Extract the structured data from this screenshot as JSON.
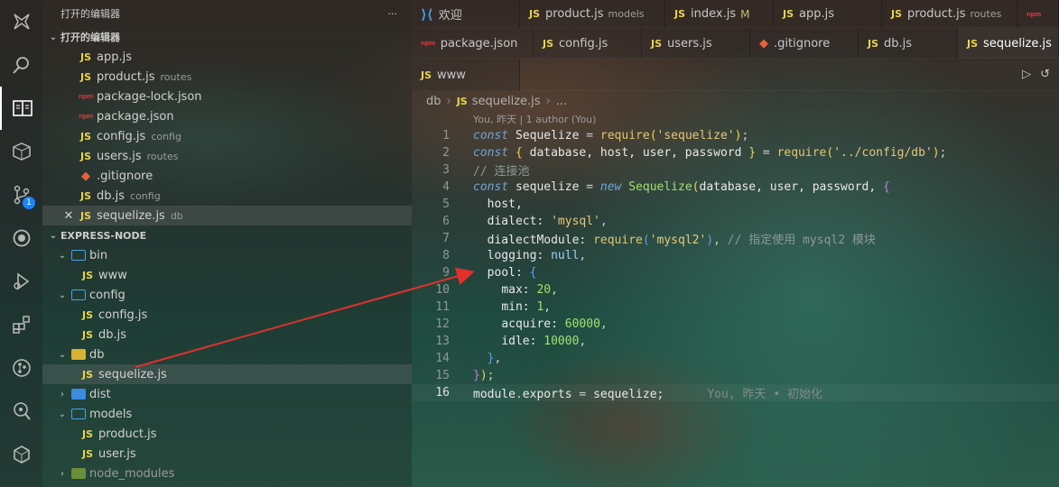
{
  "sidebar": {
    "title": "打开的编辑器",
    "more_label": "···",
    "open_editors_header": "打开的编辑器",
    "open_editors": [
      {
        "icon": "JS",
        "name": "app.js",
        "desc": ""
      },
      {
        "icon": "JS",
        "name": "product.js",
        "desc": "routes"
      },
      {
        "icon": "npm",
        "name": "package-lock.json",
        "desc": ""
      },
      {
        "icon": "npm",
        "name": "package.json",
        "desc": ""
      },
      {
        "icon": "JS",
        "name": "config.js",
        "desc": "config"
      },
      {
        "icon": "JS",
        "name": "users.js",
        "desc": "routes"
      },
      {
        "icon": "git",
        "name": ".gitignore",
        "desc": ""
      },
      {
        "icon": "JS",
        "name": "db.js",
        "desc": "config"
      },
      {
        "icon": "JS",
        "name": "sequelize.js",
        "desc": "db"
      }
    ],
    "project_header": "EXPRESS-NODE",
    "tree": {
      "bin": "bin",
      "bin_www": "www",
      "config": "config",
      "config_config": "config.js",
      "config_db": "db.js",
      "db": "db",
      "db_sequelize": "sequelize.js",
      "dist": "dist",
      "models": "models",
      "models_product": "product.js",
      "models_user": "user.js",
      "node_modules": "node_modules"
    }
  },
  "activity_badge": "1",
  "tabs_row1": [
    {
      "label": "欢迎",
      "desc": ""
    },
    {
      "label": "product.js",
      "desc": "models"
    },
    {
      "label": "index.js",
      "mod": "M"
    },
    {
      "label": "app.js",
      "desc": ""
    },
    {
      "label": "product.js",
      "desc": "routes"
    }
  ],
  "tabs_row2": [
    {
      "label": "package.json"
    },
    {
      "label": "config.js"
    },
    {
      "label": "users.js"
    },
    {
      "label": ".gitignore"
    },
    {
      "label": "db.js"
    },
    {
      "label": "sequelize.js"
    }
  ],
  "tabs_row3": [
    {
      "label": "www"
    }
  ],
  "breadcrumb": {
    "folder": "db",
    "file": "sequelize.js",
    "more": "..."
  },
  "blame_top": "You, 昨天 | 1 author (You)",
  "blame_inline": "You, 昨天 • 初始化",
  "line_numbers": [
    "1",
    "2",
    "3",
    "4",
    "5",
    "6",
    "7",
    "8",
    "9",
    "10",
    "11",
    "12",
    "13",
    "14",
    "15",
    "16"
  ],
  "code": {
    "l1": {
      "kw": "const",
      "var": "Sequelize",
      "eq": "=",
      "fn": "require",
      "arg": "'sequelize'"
    },
    "l2": {
      "kw": "const",
      "vars": "database, host, user, password",
      "eq": "=",
      "fn": "require",
      "arg": "'../config/db'"
    },
    "l3": "// 连接池",
    "l4": {
      "kw": "const",
      "var": "sequelize",
      "eq": "=",
      "new": "new",
      "cls": "Sequelize",
      "args": "database, user, password,"
    },
    "l5": "host,",
    "l6": {
      "key": "dialect:",
      "val": "'mysql'"
    },
    "l7": {
      "key": "dialectModule:",
      "fn": "require",
      "arg": "'mysql2'",
      "comment": "// 指定使用 mysql2 模块"
    },
    "l8": {
      "key": "logging:",
      "val": "null"
    },
    "l9": {
      "key": "pool:"
    },
    "l10": {
      "key": "max:",
      "val": "20"
    },
    "l11": {
      "key": "min:",
      "val": "1"
    },
    "l12": {
      "key": "acquire:",
      "val": "60000"
    },
    "l13": {
      "key": "idle:",
      "val": "10000"
    },
    "l16": {
      "obj": "module",
      "prop": "exports",
      "eq": "=",
      "val": "sequelize;"
    }
  }
}
